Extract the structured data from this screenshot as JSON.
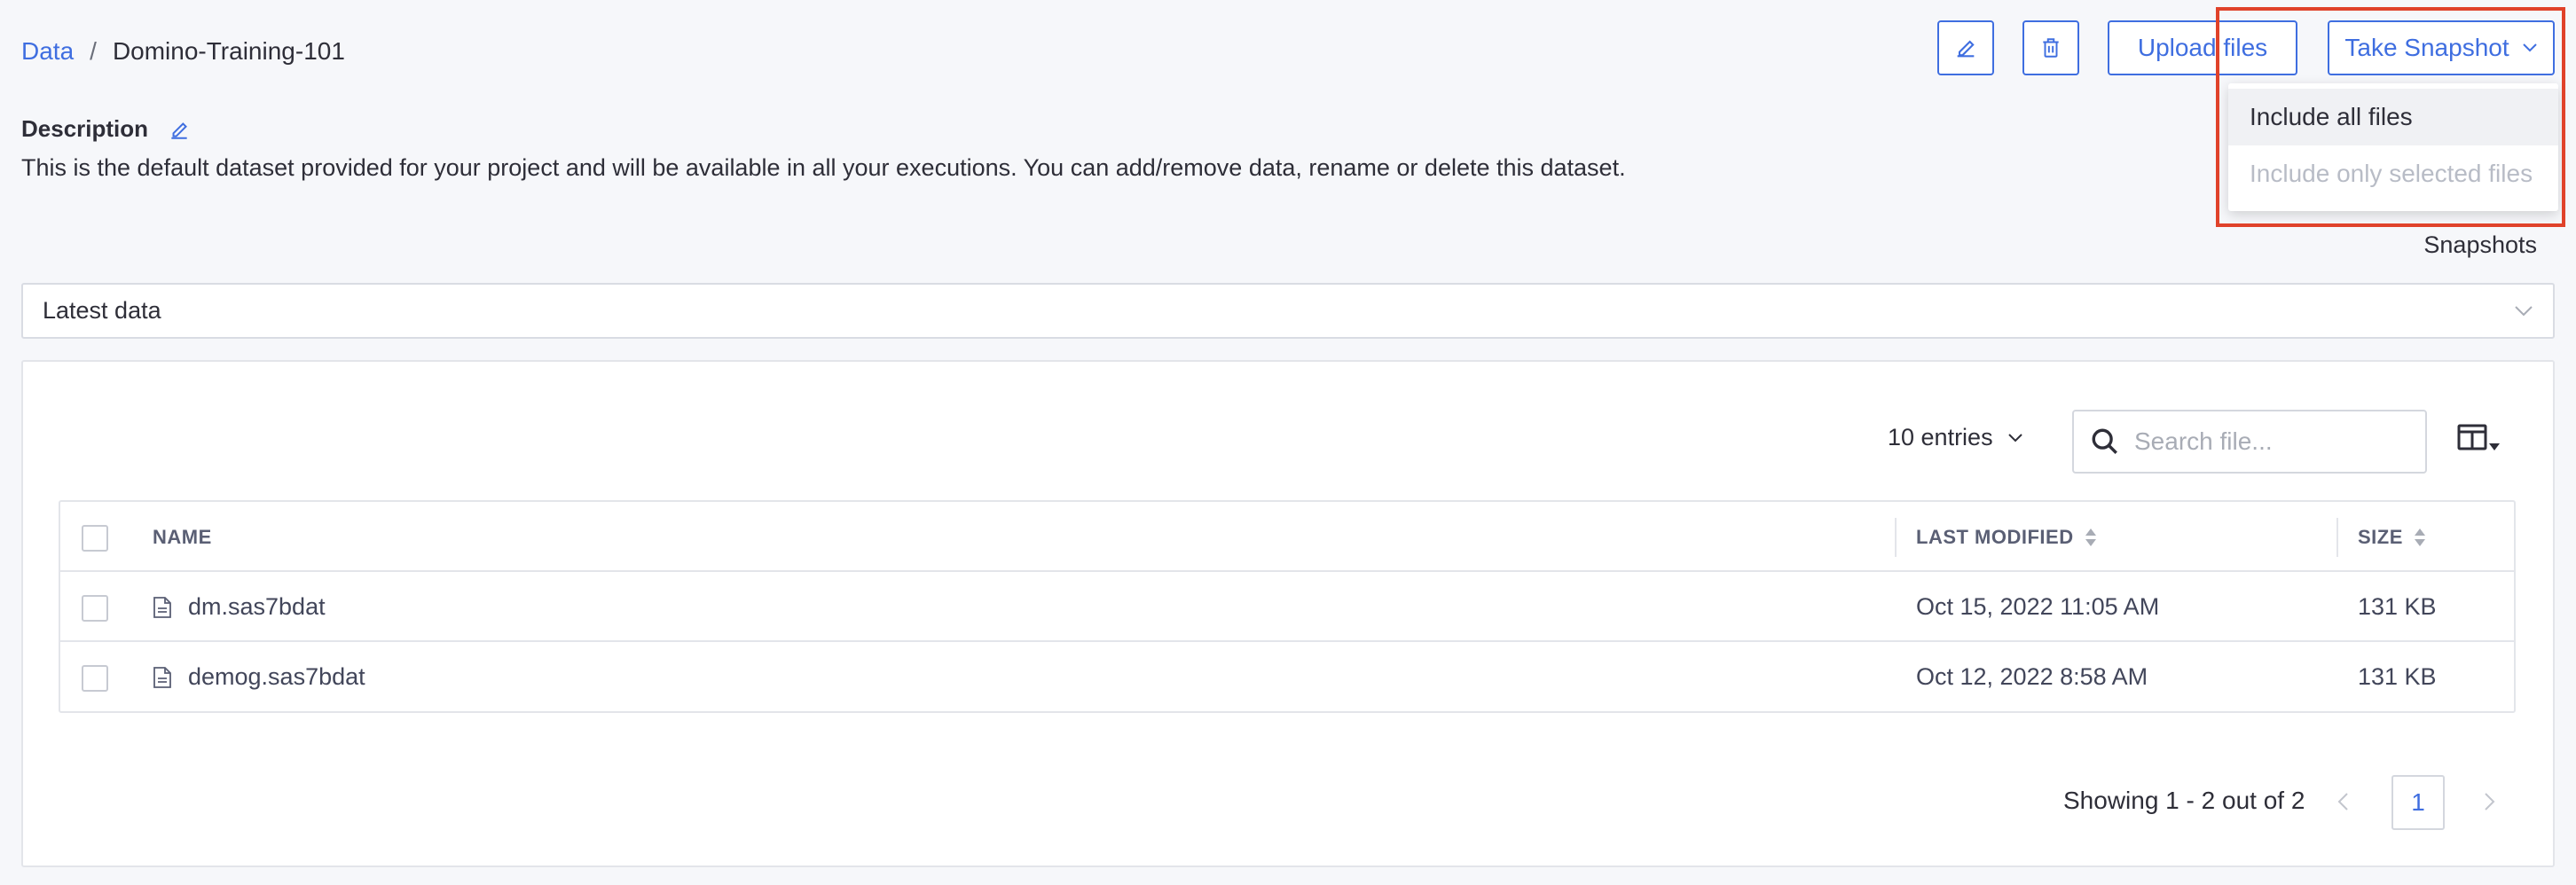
{
  "breadcrumb": {
    "root": "Data",
    "separator": "/",
    "current": "Domino-Training-101"
  },
  "toolbar": {
    "edit_icon": "pencil-icon",
    "delete_icon": "trash-icon",
    "upload_label": "Upload files",
    "snapshot_label": "Take Snapshot"
  },
  "snapshot_menu": {
    "items": [
      {
        "label": "Include all files",
        "state": "hover"
      },
      {
        "label": "Include only selected files",
        "state": "disabled"
      }
    ]
  },
  "description": {
    "label": "Description",
    "text": "This is the default dataset provided for your project and will be available in all your executions. You can add/remove data, rename or delete this dataset."
  },
  "snapshots_label": "Snapshots",
  "data_select": {
    "value": "Latest data"
  },
  "file_table": {
    "entries_label": "10 entries",
    "search_placeholder": "Search file...",
    "columns": [
      "NAME",
      "LAST MODIFIED",
      "SIZE"
    ],
    "rows": [
      {
        "name": "dm.sas7bdat",
        "modified": "Oct 15, 2022 11:05 AM",
        "size": "131 KB"
      },
      {
        "name": "demog.sas7bdat",
        "modified": "Oct 12, 2022 8:58 AM",
        "size": "131 KB"
      }
    ]
  },
  "pagination": {
    "summary": "Showing 1 - 2 out of 2",
    "current_page": "1"
  },
  "colors": {
    "accent": "#3f6ee0",
    "highlight": "#e0422a"
  }
}
